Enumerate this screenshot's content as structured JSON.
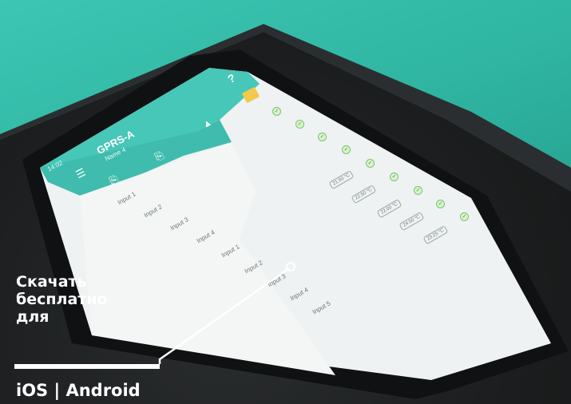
{
  "app": {
    "status_time": "14:02",
    "device_name": "GPRS-A",
    "device_subtitle": "Name 4",
    "help_icon": "question-icon",
    "menu_icon": "hamburger-icon"
  },
  "inputs_left": [
    "Input 1",
    "Input 2",
    "Input 3",
    "Input 4"
  ],
  "inputs_right": [
    "Input 1",
    "Input 2",
    "Input 3",
    "Input 4",
    "Input 5"
  ],
  "temperatures": [
    "21.50 °C",
    "22.50 °C",
    "22.00 °C",
    "24.50 °C",
    "23.25 °C"
  ],
  "promo": {
    "line1": "Скачать",
    "line2": "бесплатно",
    "line3": "для",
    "platforms": "iOS | Android"
  },
  "colors": {
    "accent_teal": "#46c7b8",
    "check_green": "#7cc46a"
  }
}
